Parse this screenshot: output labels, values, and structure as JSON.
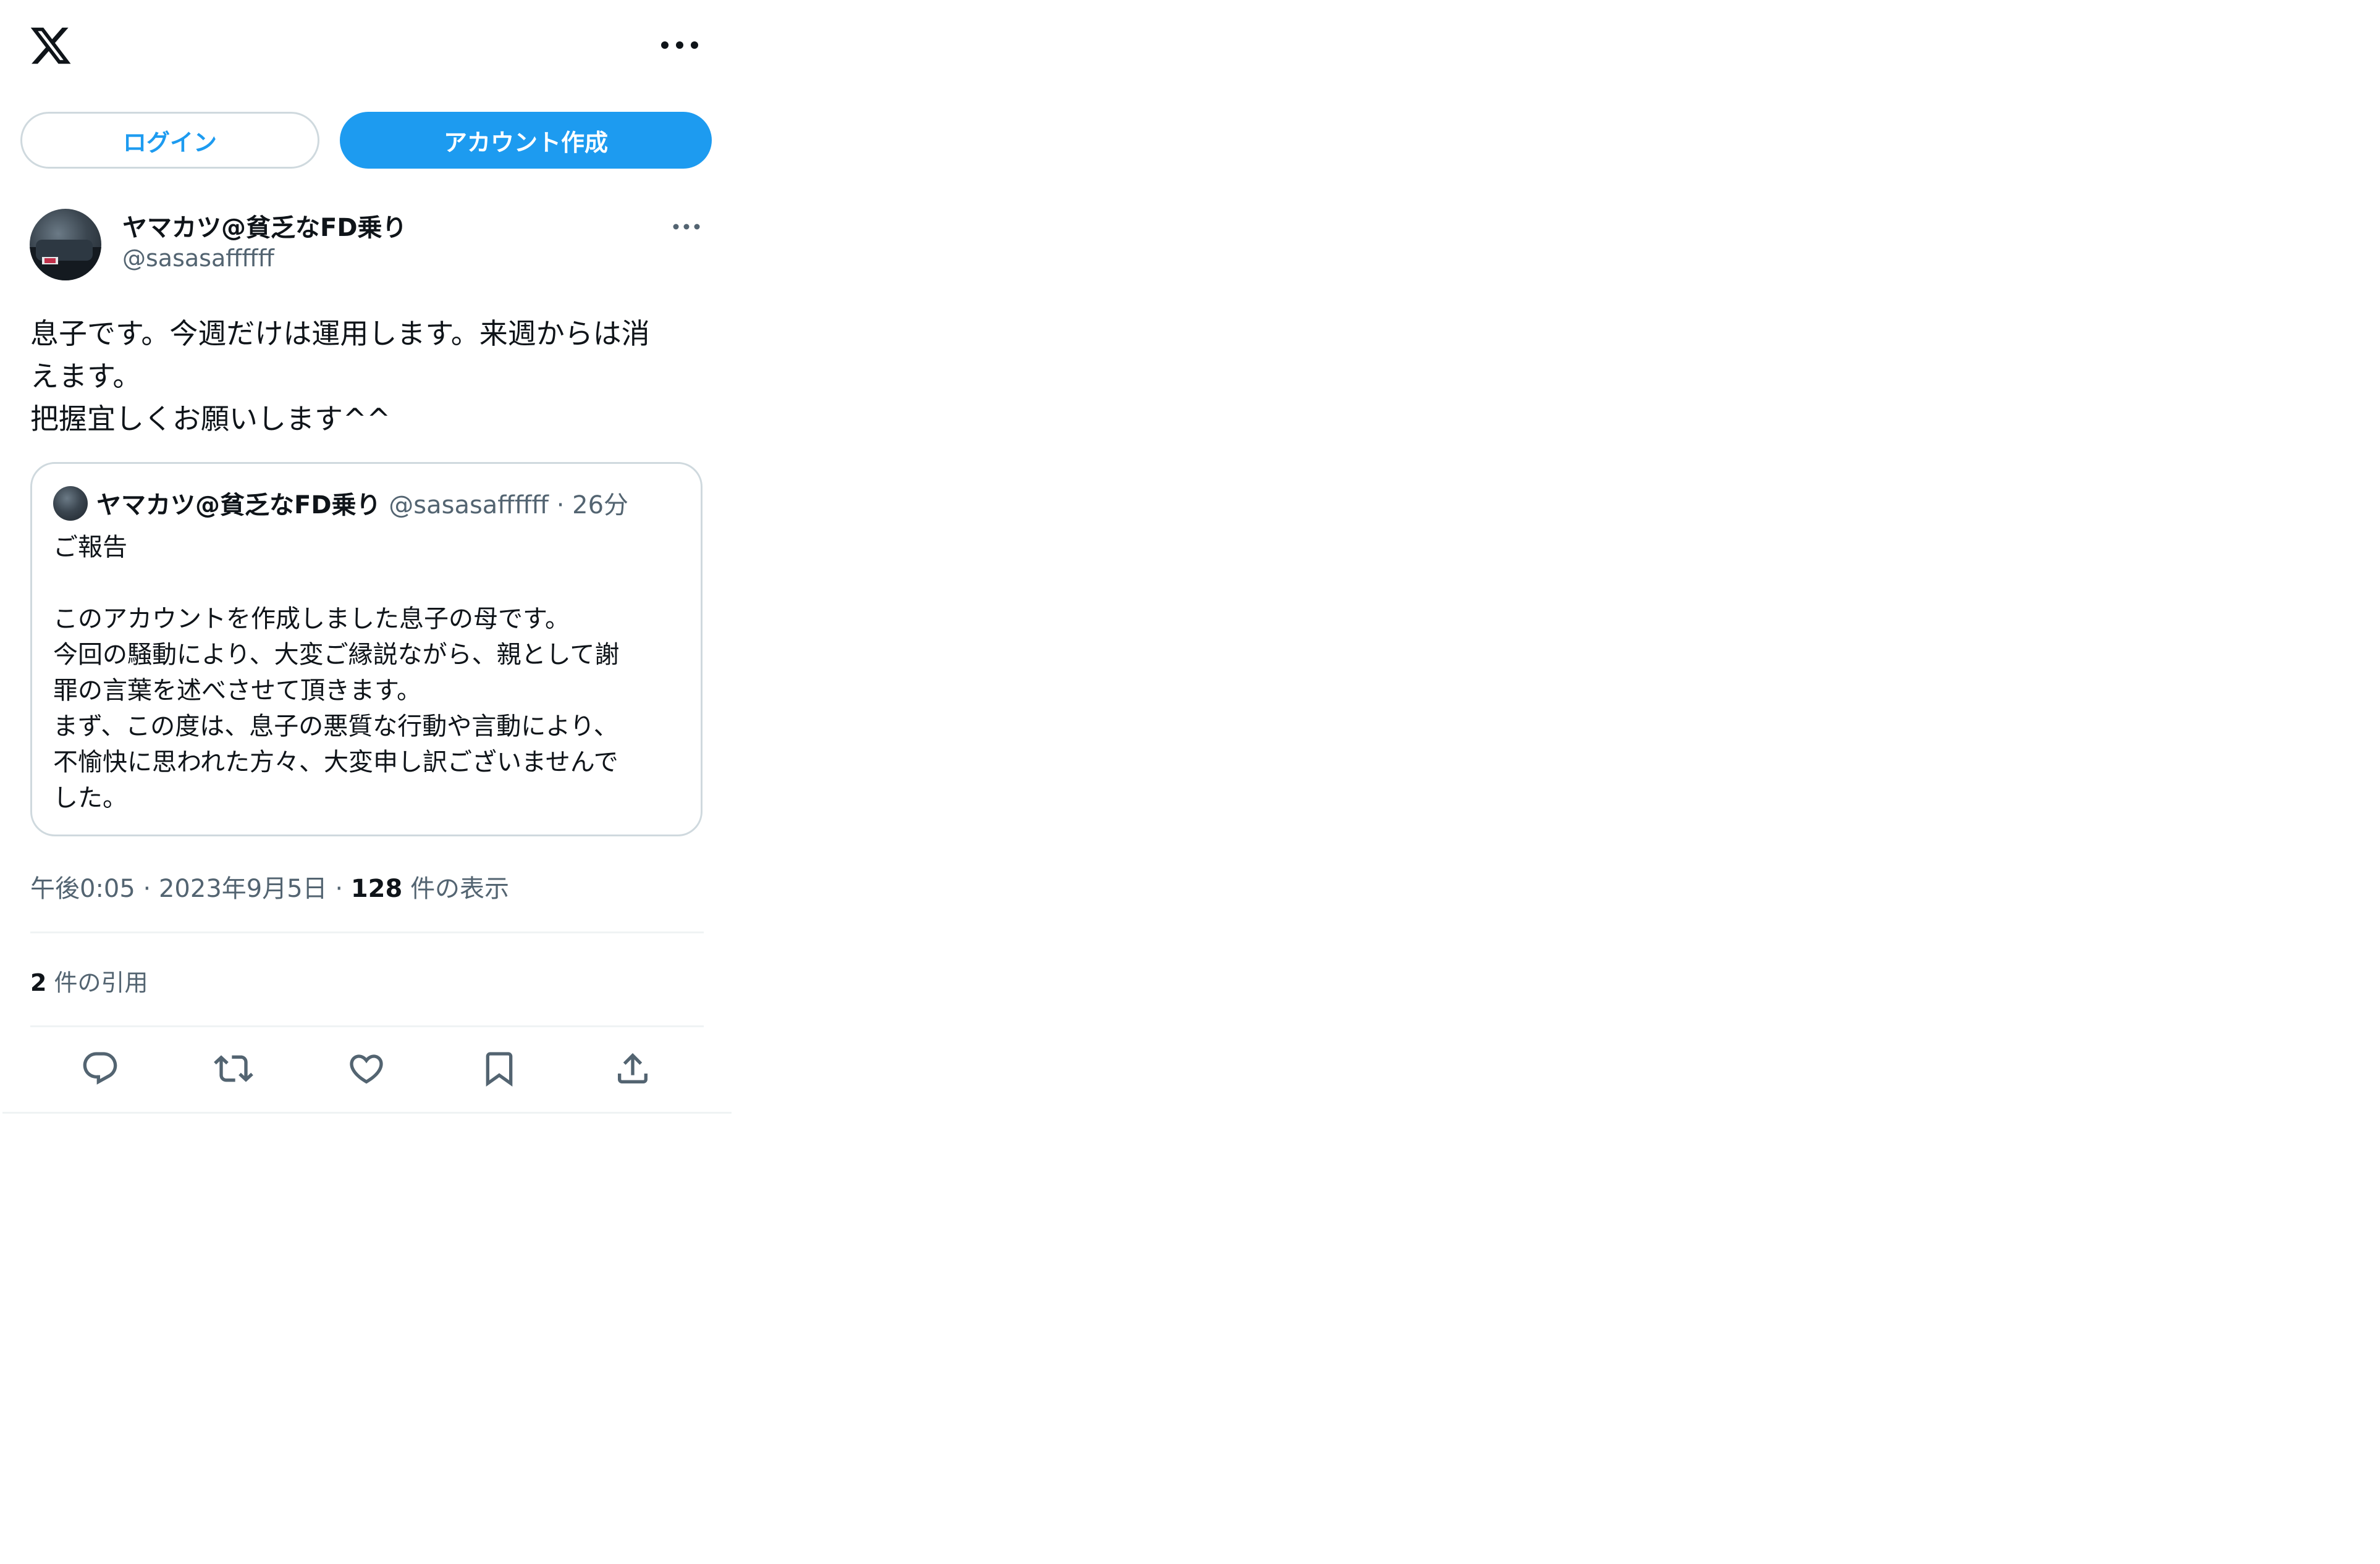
{
  "header": {
    "logo_icon": "x-logo-icon",
    "more_icon": "more-horizontal-icon"
  },
  "auth": {
    "login_label": "ログイン",
    "signup_label": "アカウント作成"
  },
  "post": {
    "author_name": "ヤマカツ@貧乏なFD乗り",
    "author_handle": "@sasasaffffff",
    "text": "息子です。今週だけは運用します。来週からは消\nえます。\n把握宜しくお願いします^^",
    "timestamp": "午後0:05",
    "date": "2023年9月5日",
    "views_count": "128",
    "views_label": "件の表示",
    "quotes_count": "2",
    "quotes_label": "件の引用"
  },
  "quoted_post": {
    "author_name": "ヤマカツ@貧乏なFD乗り",
    "author_handle": "@sasasaffffff",
    "separator": "·",
    "time": "26分",
    "text": "ご報告\n\nこのアカウントを作成しました息子の母です。\n今回の騒動により、大変ご縁説ながら、親として謝\n罪の言葉を述べさせて頂きます。\nまず、この度は、息子の悪質な行動や言動により、\n不愉快に思われた方々、大変申し訳ございませんで\nした。"
  },
  "actions": [
    "reply-icon",
    "repost-icon",
    "like-icon",
    "bookmark-icon",
    "share-icon"
  ],
  "colors": {
    "accent": "#1d9bf0",
    "text": "#0f1419",
    "secondary": "#536471",
    "border": "#cfd9de"
  }
}
